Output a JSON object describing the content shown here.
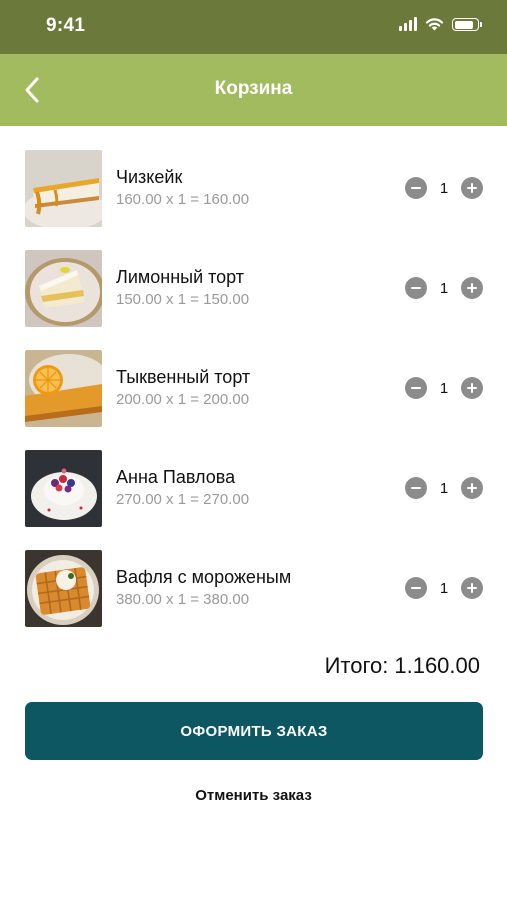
{
  "status_bar": {
    "time": "9:41",
    "signal_icon": "cellular-signal-icon",
    "wifi_icon": "wifi-icon",
    "battery_icon": "battery-icon",
    "battery_level": 0.9
  },
  "header": {
    "title": "Корзина",
    "back_icon": "chevron-left-icon",
    "background_color": "#a1bb5e",
    "status_color": "#6b7a3a"
  },
  "cart": {
    "items": [
      {
        "name": "Чизкейк",
        "calc": "160.00 x 1 = 160.00",
        "qty": "1",
        "image": "cheesecake-photo"
      },
      {
        "name": "Лимонный торт",
        "calc": "150.00 x 1 = 150.00",
        "qty": "1",
        "image": "lemon-cake-photo"
      },
      {
        "name": "Тыквенный торт",
        "calc": "200.00 x 1 = 200.00",
        "qty": "1",
        "image": "pumpkin-cake-photo"
      },
      {
        "name": "Анна Павлова",
        "calc": "270.00 x 1 = 270.00",
        "qty": "1",
        "image": "pavlova-photo"
      },
      {
        "name": "Вафля с мороженым",
        "calc": "380.00 x 1 = 380.00",
        "qty": "1",
        "image": "waffle-photo"
      }
    ],
    "minus_icon": "minus-circle-icon",
    "plus_icon": "plus-circle-icon"
  },
  "summary": {
    "total_label": "Итого:",
    "total_value": "1.160.00"
  },
  "actions": {
    "checkout_label": "ОФОРМИТЬ ЗАКАЗ",
    "cancel_label": "Отменить заказ",
    "checkout_color": "#0d5763"
  }
}
